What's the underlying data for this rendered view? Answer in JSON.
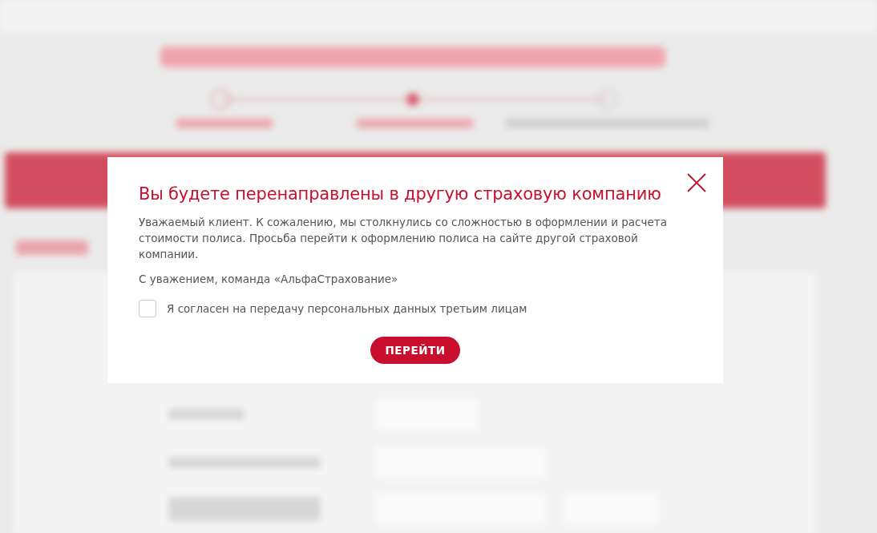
{
  "dialog": {
    "title": "Вы будете перенаправлены в другую страховую компанию",
    "paragraphs": [
      "Уважаемый клиент. К сожалению, мы столкнулись со сложностью в оформлении и расчета стоимости полиса. Просьба перейти к оформлению полиса на сайте другой страховой компании.",
      "С уважением, команда «АльфаСтрахование»"
    ],
    "consent": {
      "label": "Я согласен на передачу персональных данных третьим лицам",
      "checked": false
    },
    "button": "ПЕРЕЙТИ"
  }
}
